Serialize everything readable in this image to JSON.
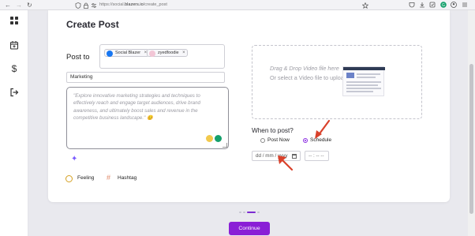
{
  "browser": {
    "url_prefix": "https://social.",
    "url_host": "blazers.io",
    "url_path": "/create_post",
    "icons": [
      "back-icon",
      "forward-icon",
      "reload-icon",
      "shield-icon",
      "lock-icon",
      "bookmark-star-icon",
      "pocket-icon",
      "download-icon",
      "extensions-icon",
      "grammarly-icon",
      "profile-icon",
      "menu-icon"
    ]
  },
  "rail": {
    "items": [
      "dashboard-icon",
      "calendar-icon",
      "dollar-icon",
      "logout-icon"
    ]
  },
  "page": {
    "title": "Create Post",
    "post_to_label": "Post to",
    "accounts": [
      {
        "name": "Social Blazer",
        "color": "#1877f2"
      },
      {
        "name": "zyedfoodie",
        "color": "#e1306c"
      }
    ],
    "remove_glyph": "×",
    "category": "Marketing",
    "caption": "\"Explore innovative marketing strategies and techniques to effectively reach and engage target audiences, drive brand awareness, and ultimately boost sales and revenue in the competitive business landscape.\" 😊",
    "feeling_label": "Feeling",
    "hashtag_label": "Hashtag",
    "upload": {
      "line1": "Drag & Drop Video file here",
      "line2": "Or select a Video file to upload"
    },
    "when_label": "When to post?",
    "options": [
      {
        "label": "Post Now",
        "selected": false
      },
      {
        "label": "Schedule",
        "selected": true
      }
    ],
    "date_placeholder": "dd / mm / yyyy",
    "time_placeholder": "-- : -- --",
    "continue_label": "Continue",
    "steps": {
      "count": 4,
      "active": 2
    }
  },
  "colors": {
    "accent": "#8a1fd6",
    "annotation_arrow": "#d9412b"
  }
}
